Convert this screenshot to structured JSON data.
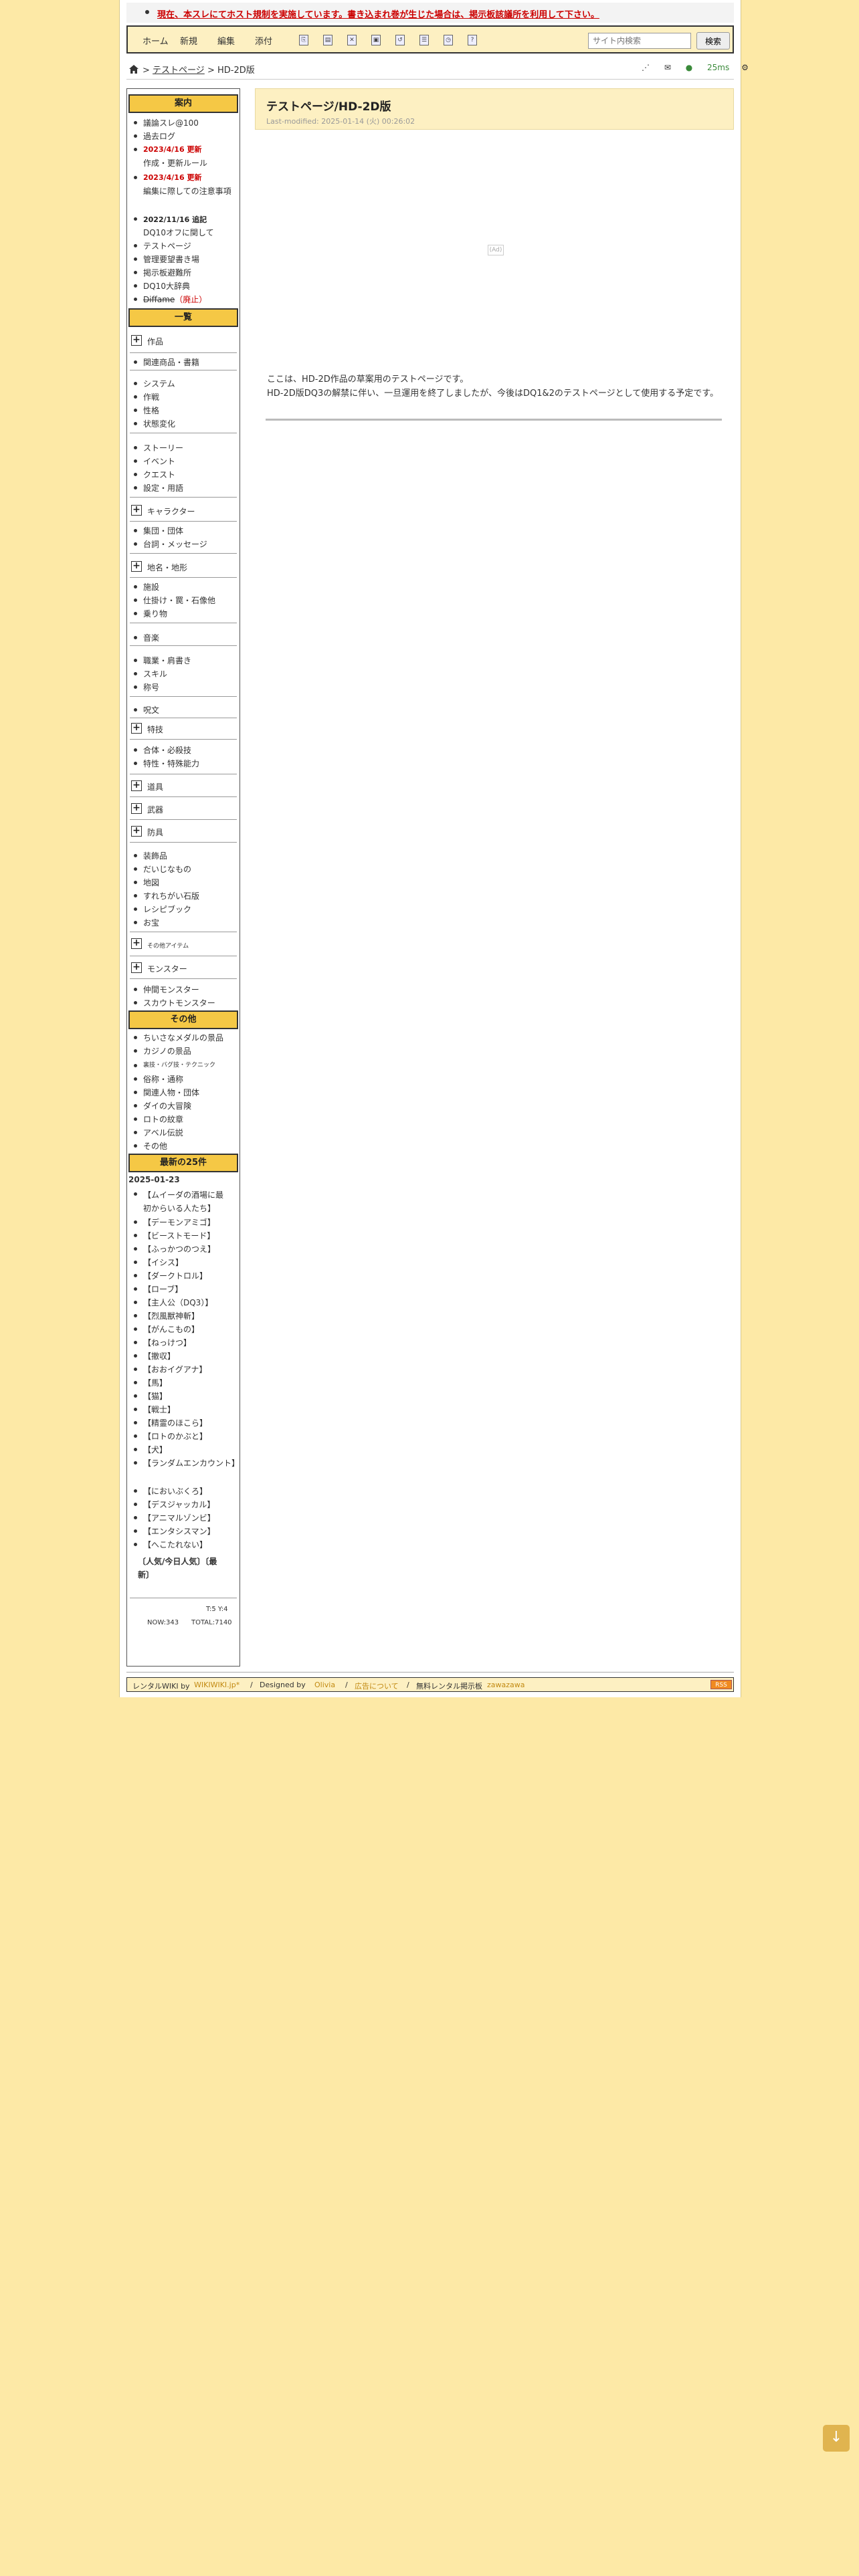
{
  "notice": "現在、本スレにてホスト規制を実施しています。書き込まれ巻が生じた場合は、掲示板該議所を利用して下さい。",
  "toolbar": {
    "home": "ホーム",
    "new": "新規",
    "edit": "編集",
    "attach": "添付",
    "search_placeholder": "サイト内検索",
    "search_button": "検索"
  },
  "breadcrumb": {
    "sep1": ">",
    "parent": "テストページ",
    "sep2": ">",
    "current": "HD-2D版"
  },
  "perf": "25ms",
  "sidebar": {
    "guide_header": "案内",
    "guide_items": [
      "議論スレ@100",
      "過去ログ"
    ],
    "update1_date": "2023/4/16 更新",
    "update1_label": "作成・更新ルール",
    "update2_date": "2023/4/16 更新",
    "update2_label": "編集に際しての注意事項",
    "update3_date": "2022/11/16 追記",
    "update3_label": "DQ10オフに関して",
    "guide_items2": [
      "テストページ",
      "管理要望書き場",
      "掲示板避難所",
      "DQ10大辞典"
    ],
    "diffame": "Diffame",
    "diffame_status": "（廃止）",
    "list_header": "一覧",
    "works": "作品",
    "related_goods": "関連商品・書籍",
    "system_items": [
      "システム",
      "作戦",
      "性格",
      "状態変化"
    ],
    "story_items": [
      "ストーリー",
      "イベント",
      "クエスト",
      "設定・用語"
    ],
    "character": "キャラクター",
    "char_items": [
      "集団・団体",
      "台詞・メッセージ"
    ],
    "place": "地名・地形",
    "place_items": [
      "施設",
      "仕掛け・罠・石像他",
      "乗り物"
    ],
    "music": "音楽",
    "job_items": [
      "職業・肩書き",
      "スキル",
      "称号"
    ],
    "spell": "呪文",
    "special": "特技",
    "special_items": [
      "合体・必殺技",
      "特性・特殊能力"
    ],
    "tools": "道具",
    "weapons": "武器",
    "armor": "防具",
    "misc_items": [
      "装飾品",
      "だいじなもの",
      "地図",
      "すれちがい石版",
      "レシピブック",
      "お宝"
    ],
    "other_items": "その他アイテム",
    "monster": "モンスター",
    "monster_items": [
      "仲間モンスター",
      "スカウトモンスター"
    ],
    "other_header": "その他",
    "other_list": [
      "ちいさなメダルの景品",
      "カジノの景品"
    ],
    "bugs": "裏技・バグ技・テクニック",
    "other_list2": [
      "俗称・通称",
      "関連人物・団体",
      "ダイの大冒険",
      "ロトの紋章",
      "アベル伝説",
      "その他"
    ],
    "recent_header": "最新の25件",
    "recent_date": "2025-01-23",
    "recent_items": [
      "【ムイーダの酒場に最初からいる人たち】",
      "【デーモンアミゴ】",
      "【ビーストモード】",
      "【ふっかつのつえ】",
      "【イシス】",
      "【ダークトロル】",
      "【ローブ】",
      "【主人公（DQ3）】",
      "【烈風獣神斬】",
      "【がんこもの】",
      "【ねっけつ】",
      "【撤収】",
      "【おおイグアナ】",
      "【馬】",
      "【猫】",
      "【戦士】",
      "【精霊のほこら】",
      "【ロトのかぶと】",
      "【犬】",
      "【ランダムエンカウント】",
      "【においぶくろ】",
      "【デスジャッカル】",
      "【アニマルゾンビ】",
      "【エンタシスマン】",
      "【へこたれない】"
    ],
    "popular": "〔人気/今日人気〕〔最新〕",
    "counter_ts": "T:5  Y:4",
    "counter_now": "NOW:343",
    "counter_total": "TOTAL:7140"
  },
  "page": {
    "title": "テストページ/HD-2D版",
    "last_modified": "Last-modified: 2025-01-14 (火) 00:26:02",
    "ad": "(Ad)",
    "body1": "ここは、HD-2D作品の草案用のテストページです。",
    "body2": "HD-2D版DQ3の解禁に伴い、一旦運用を終了しましたが、今後はDQ1&2のテストページとして使用する予定です。"
  },
  "footer": {
    "prefix": "レンタルWIKI by",
    "wikiwiki": "WIKIWIKI.jp*",
    "designed": "Designed by",
    "designer": "Olivia",
    "ad_link": "広告について",
    "rental": "無料レンタル掲示板",
    "zawazawa": "zawazawa",
    "rss": "RSS"
  },
  "scroll_icon": "arrow-down-icon"
}
